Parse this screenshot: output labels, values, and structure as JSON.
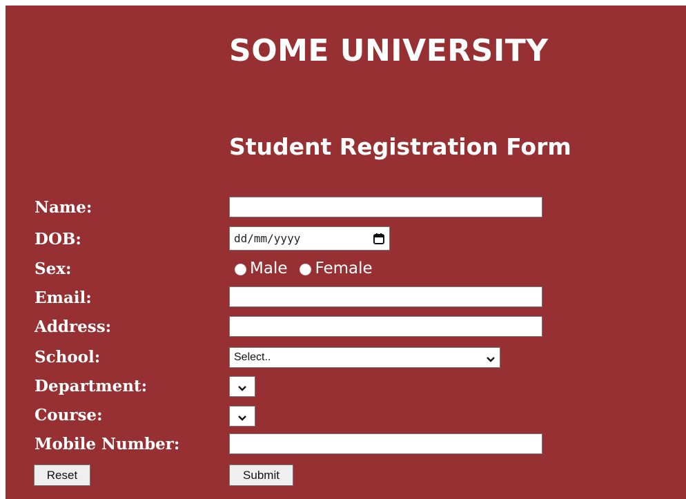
{
  "header": {
    "university": "SOME UNIVERSITY",
    "form_title": "Student Registration Form"
  },
  "form": {
    "labels": {
      "name": "Name:",
      "dob": "DOB:",
      "sex": "Sex:",
      "email": "Email:",
      "address": "Address:",
      "school": "School:",
      "department": "Department:",
      "course": "Course:",
      "mobile": "Mobile Number:"
    },
    "values": {
      "name": "",
      "email": "",
      "address": "",
      "mobile": ""
    },
    "dob_placeholder": "dd/mm/yyyy",
    "sex_options": [
      "Male",
      "Female"
    ],
    "school_selected": "Select..",
    "department_selected": "",
    "course_selected": ""
  },
  "buttons": {
    "reset": "Reset",
    "submit": "Submit"
  },
  "colors": {
    "background": "#973032",
    "text": "#ffffff"
  },
  "icons": {
    "dob": "calendar-icon",
    "select": "chevron-down-icon",
    "radio": "radio-button"
  }
}
